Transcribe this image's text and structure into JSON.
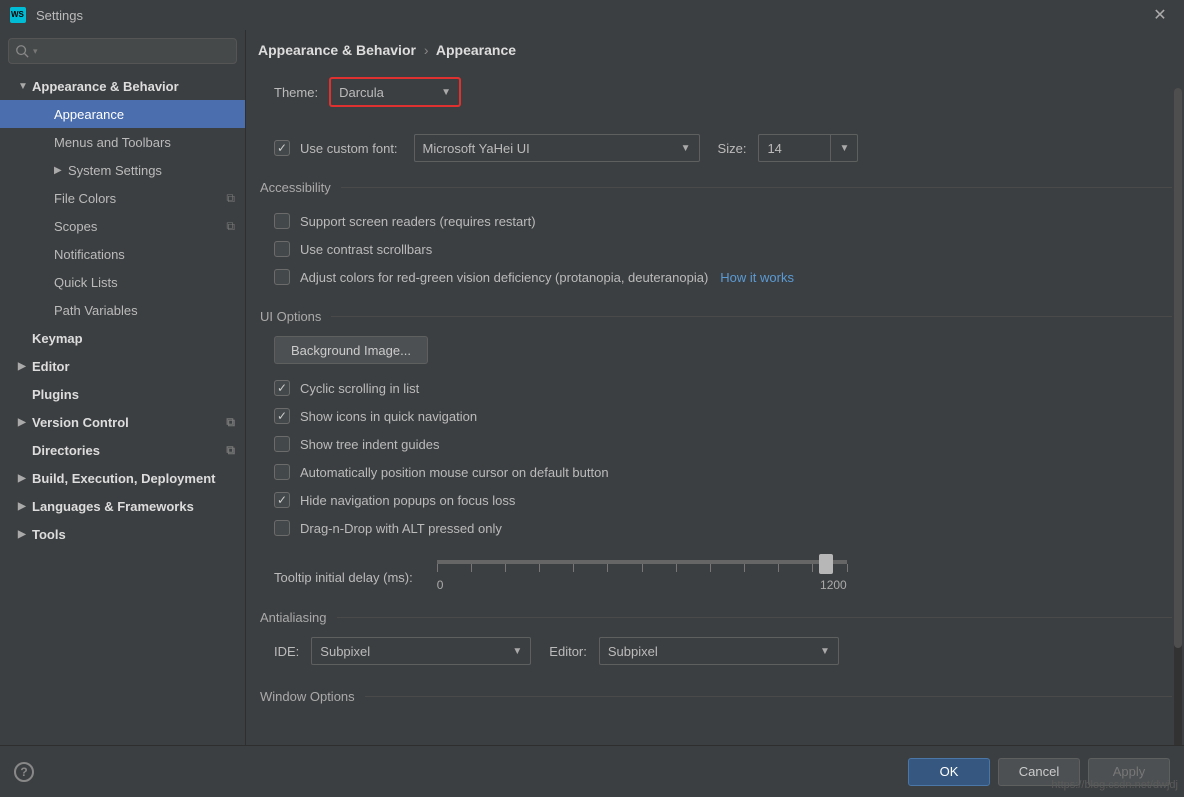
{
  "title": "Settings",
  "breadcrumb": {
    "parent": "Appearance & Behavior",
    "current": "Appearance"
  },
  "sidebar": {
    "search_placeholder": "",
    "items": [
      {
        "label": "Appearance & Behavior",
        "level": 1,
        "bold": true,
        "arrow": "down"
      },
      {
        "label": "Appearance",
        "level": 2,
        "selected": true
      },
      {
        "label": "Menus and Toolbars",
        "level": 2
      },
      {
        "label": "System Settings",
        "level": 2,
        "arrow": "right"
      },
      {
        "label": "File Colors",
        "level": 2,
        "copy": true
      },
      {
        "label": "Scopes",
        "level": 2,
        "copy": true
      },
      {
        "label": "Notifications",
        "level": 2
      },
      {
        "label": "Quick Lists",
        "level": 2
      },
      {
        "label": "Path Variables",
        "level": 2
      },
      {
        "label": "Keymap",
        "level": 1,
        "bold": true,
        "noarrow": true
      },
      {
        "label": "Editor",
        "level": 1,
        "bold": true,
        "arrow": "right"
      },
      {
        "label": "Plugins",
        "level": 1,
        "bold": true,
        "noarrow": true
      },
      {
        "label": "Version Control",
        "level": 1,
        "bold": true,
        "arrow": "right",
        "copy": true
      },
      {
        "label": "Directories",
        "level": 1,
        "bold": true,
        "noarrow": true,
        "copy": true
      },
      {
        "label": "Build, Execution, Deployment",
        "level": 1,
        "bold": true,
        "arrow": "right"
      },
      {
        "label": "Languages & Frameworks",
        "level": 1,
        "bold": true,
        "arrow": "right"
      },
      {
        "label": "Tools",
        "level": 1,
        "bold": true,
        "arrow": "right"
      }
    ]
  },
  "theme": {
    "label": "Theme:",
    "value": "Darcula"
  },
  "font": {
    "checkbox_label": "Use custom font:",
    "value": "Microsoft YaHei UI",
    "size_label": "Size:",
    "size_value": "14"
  },
  "sections": {
    "accessibility": "Accessibility",
    "ui_options": "UI Options",
    "antialiasing": "Antialiasing",
    "window_options": "Window Options"
  },
  "accessibility": {
    "screen_readers": "Support screen readers (requires restart)",
    "contrast": "Use contrast scrollbars",
    "colorblind": "Adjust colors for red-green vision deficiency (protanopia, deuteranopia)",
    "how_link": "How it works"
  },
  "ui": {
    "bg_button": "Background Image...",
    "cyclic": "Cyclic scrolling in list",
    "icons_nav": "Show icons in quick navigation",
    "tree_guides": "Show tree indent guides",
    "auto_cursor": "Automatically position mouse cursor on default button",
    "hide_popups": "Hide navigation popups on focus loss",
    "dnd_alt": "Drag-n-Drop with ALT pressed only",
    "tooltip_label": "Tooltip initial delay (ms):",
    "slider_min": "0",
    "slider_max": "1200"
  },
  "antialiasing": {
    "ide_label": "IDE:",
    "ide_value": "Subpixel",
    "editor_label": "Editor:",
    "editor_value": "Subpixel"
  },
  "footer": {
    "ok": "OK",
    "cancel": "Cancel",
    "apply": "Apply"
  },
  "watermark": "https://blog.csdn.net/dwjdj"
}
